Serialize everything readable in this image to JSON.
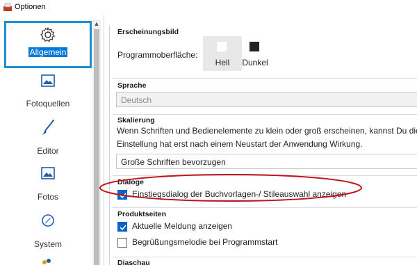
{
  "window": {
    "title": "Optionen",
    "app_icon": "app-icon"
  },
  "sidebar": {
    "items": [
      {
        "label": "Allgemein",
        "icon": "gear-icon",
        "selected": true
      },
      {
        "label": "Fotoquellen",
        "icon": "image-icon",
        "selected": false
      },
      {
        "label": "Editor",
        "icon": "brush-icon",
        "selected": false
      },
      {
        "label": "Fotos",
        "icon": "photo-icon",
        "selected": false
      },
      {
        "label": "System",
        "icon": "compass-icon",
        "selected": false
      }
    ]
  },
  "appearance": {
    "title": "Erscheinungsbild",
    "label": "Programmoberfläche:",
    "options": [
      {
        "label": "Hell",
        "selected": true,
        "color": "#ffffff"
      },
      {
        "label": "Dunkel",
        "selected": false,
        "color": "#222222"
      }
    ]
  },
  "language": {
    "title": "Sprache",
    "value": "Deutsch",
    "disabled": true
  },
  "scaling": {
    "title": "Skalierung",
    "line1": "Wenn Schriften und Bedienelemente zu klein oder groß erscheinen, kannst Du dies",
    "line2": "Einstellung hat erst nach einem Neustart der Anwendung Wirkung.",
    "value": "Große Schriften bevorzugen"
  },
  "dialogs": {
    "title": "Dialoge",
    "option": {
      "label": "Einstiegsdialog der Buchvorlagen-/ Stileauswahl anzeigen",
      "checked": true
    }
  },
  "product_pages": {
    "title": "Produktseiten",
    "options": [
      {
        "label": "Aktuelle Meldung anzeigen",
        "checked": true
      },
      {
        "label": "Begrüßungsmelodie bei Programmstart",
        "checked": false
      }
    ]
  },
  "slideshow": {
    "title": "Diaschau"
  },
  "colors": {
    "accent": "#0078d7",
    "selection_border": "#1a8fd8",
    "annotation": "#c0141c"
  }
}
